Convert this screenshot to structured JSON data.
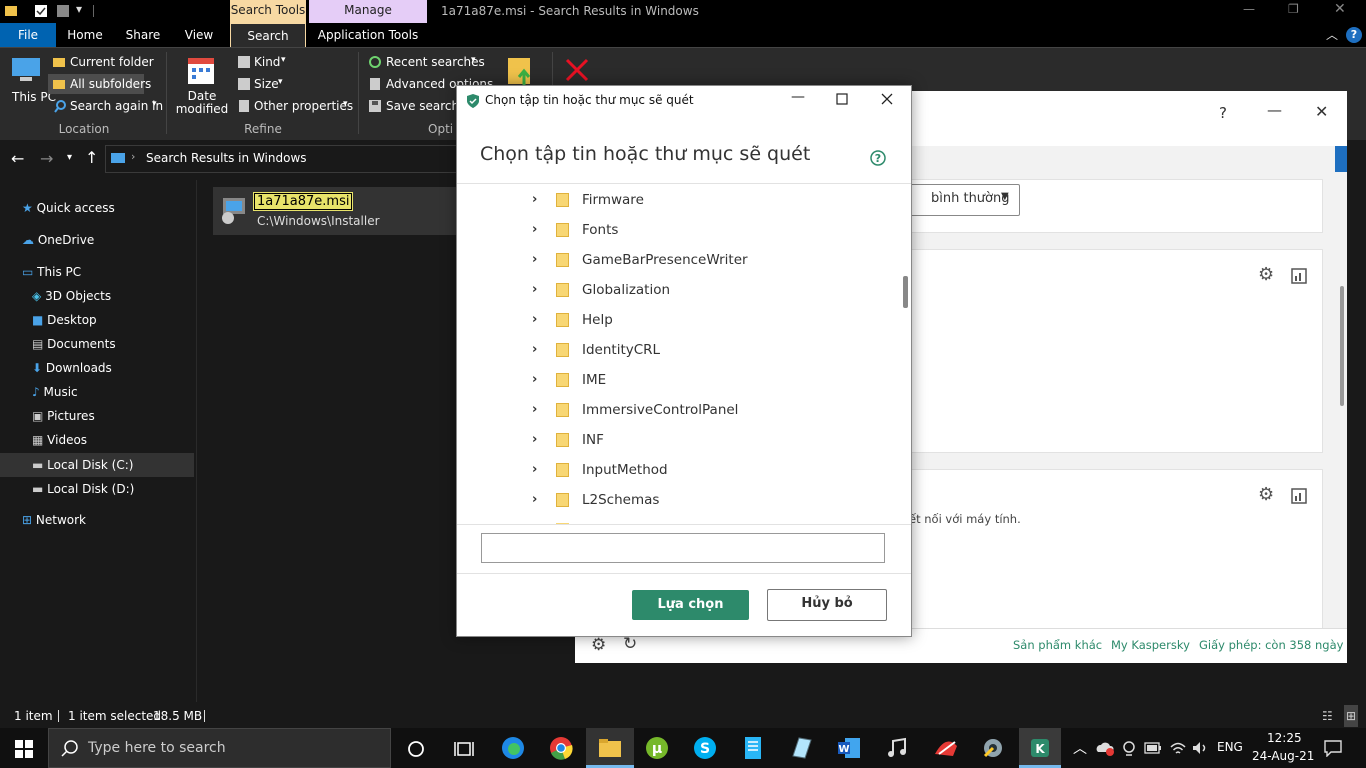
{
  "explorer": {
    "window_title": "1a71a87e.msi - Search Results in Windows",
    "context_tabs": {
      "search_tools": "Search Tools",
      "manage": "Manage"
    },
    "tabs": {
      "file": "File",
      "home": "Home",
      "share": "Share",
      "view": "View",
      "search": "Search",
      "application_tools": "Application Tools"
    },
    "ribbon": {
      "this_pc": "This PC",
      "current_folder": "Current folder",
      "all_subfolders": "All subfolders",
      "search_again_in": "Search again in",
      "location_label": "Location",
      "date_modified_1": "Date",
      "date_modified_2": "modified",
      "kind": "Kind",
      "size": "Size",
      "other_properties": "Other properties",
      "refine_label": "Refine",
      "recent_searches": "Recent searches",
      "advanced_options": "Advanced options",
      "save_search": "Save search",
      "options_label": "Opti"
    },
    "address": "Search Results in Windows",
    "nav": {
      "quick_access": "Quick access",
      "onedrive": "OneDrive",
      "this_pc": "This PC",
      "objects3d": "3D Objects",
      "desktop": "Desktop",
      "documents": "Documents",
      "downloads": "Downloads",
      "music": "Music",
      "pictures": "Pictures",
      "videos": "Videos",
      "local_c": "Local Disk (C:)",
      "local_d": "Local Disk (D:)",
      "network": "Network"
    },
    "result": {
      "name": "1a71a87e.msi",
      "path": "C:\\Windows\\Installer"
    },
    "status": {
      "count": "1 item",
      "selected": "1 item selected",
      "size": "18.5 MB"
    }
  },
  "kaspersky": {
    "help": "?",
    "dropdown": "bình thường",
    "connect_text": "ết nối với máy tính.",
    "footer": {
      "other_products": "Sản phẩm khác",
      "my_kaspersky": "My Kaspersky",
      "license": "Giấy phép: còn 358 ngày"
    }
  },
  "dialog": {
    "title_bar": "Chọn tập tin hoặc thư mục sẽ quét",
    "heading": "Chọn tập tin hoặc thư mục sẽ quét",
    "folders": [
      "Firmware",
      "Fonts",
      "GameBarPresenceWriter",
      "Globalization",
      "Help",
      "IdentityCRL",
      "IME",
      "ImmersiveControlPanel",
      "INF",
      "InputMethod",
      "L2Schemas"
    ],
    "path_value": "",
    "select_button": "Lựa chọn",
    "cancel_button": "Hủy bỏ"
  },
  "taskbar": {
    "search_placeholder": "Type here to search",
    "lang": "ENG",
    "time": "12:25",
    "date": "24-Aug-21"
  },
  "colors": {
    "accent_green": "#2d8a6b",
    "explorer_blue": "#0063b1",
    "context_search": "#f7d9a3",
    "context_manage": "#e5cdf7"
  }
}
